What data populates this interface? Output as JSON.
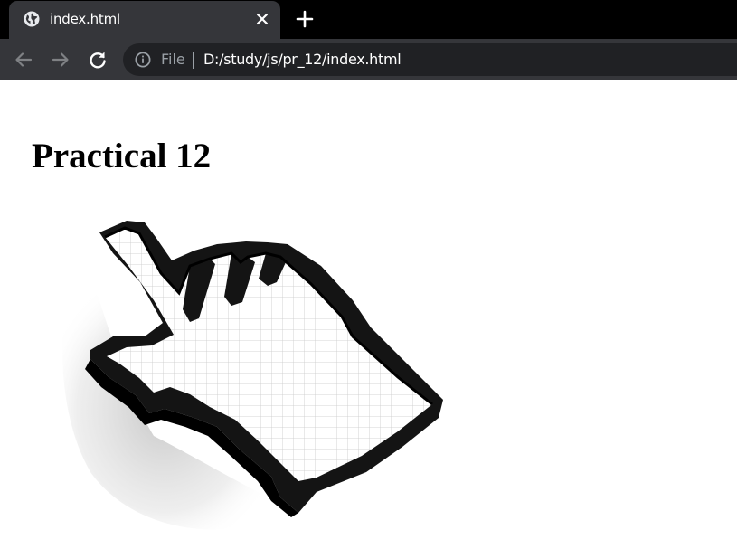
{
  "browser": {
    "tab": {
      "title": "index.html",
      "favicon": "globe-icon",
      "close_icon": "close-icon"
    },
    "new_tab_icon": "plus-icon",
    "nav": {
      "back_icon": "arrow-left-icon",
      "forward_icon": "arrow-right-icon",
      "reload_icon": "reload-icon"
    },
    "address_bar": {
      "info_icon": "info-icon",
      "scheme_label": "File",
      "url": "D:/study/js/pr_12/index.html"
    },
    "colors": {
      "tabstrip": "#000000",
      "active_tab": "#35363a",
      "toolbar": "#35363a",
      "omnibox": "#202124"
    }
  },
  "page": {
    "heading": "Practical 12",
    "image": "pixel-hand-cursor-image"
  }
}
